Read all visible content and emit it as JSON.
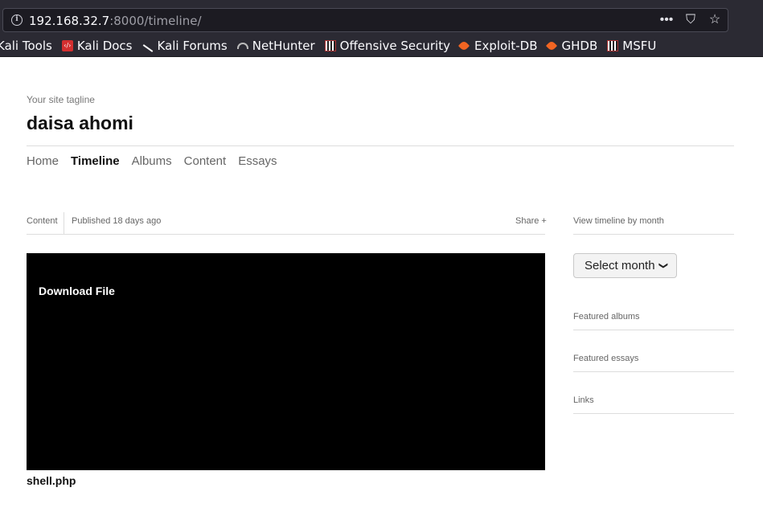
{
  "browser": {
    "url_host": "192.168.32.7",
    "url_rest": ":8000/timeline/",
    "bookmarks": [
      {
        "label": "Kali Tools",
        "icon": "none"
      },
      {
        "label": "Kali Docs",
        "icon": "kali-docs-icon"
      },
      {
        "label": "Kali Forums",
        "icon": "kali-forums-icon"
      },
      {
        "label": "NetHunter",
        "icon": "nethunter-icon"
      },
      {
        "label": "Offensive Security",
        "icon": "offsec-icon"
      },
      {
        "label": "Exploit-DB",
        "icon": "exploit-db-icon"
      },
      {
        "label": "GHDB",
        "icon": "ghdb-icon"
      },
      {
        "label": "MSFU",
        "icon": "msfu-icon"
      }
    ],
    "actions": {
      "more": "•••",
      "pocket": "⛉",
      "star": "☆"
    }
  },
  "site": {
    "tagline": "Your site tagline",
    "title": "daisa ahomi"
  },
  "nav": {
    "items": [
      "Home",
      "Timeline",
      "Albums",
      "Content",
      "Essays"
    ],
    "active": "Timeline"
  },
  "post": {
    "category": "Content",
    "published": "Published 18 days ago",
    "share": "Share +",
    "download_label": "Download File",
    "filename": "shell.php"
  },
  "sidebar": {
    "timeline_heading": "View timeline by month",
    "select_label": "Select month",
    "featured_albums": "Featured albums",
    "featured_essays": "Featured essays",
    "links": "Links"
  }
}
